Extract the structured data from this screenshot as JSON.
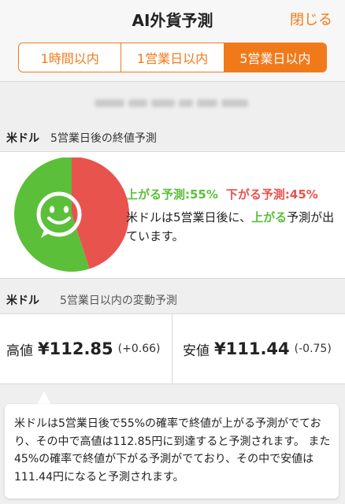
{
  "header": {
    "title": "AI外貨予測",
    "close_label": "閉じる"
  },
  "tabs": [
    {
      "label": "1時間以内",
      "active": false
    },
    {
      "label": "1営業日以内",
      "active": false
    },
    {
      "label": "5営業日以内",
      "active": true
    }
  ],
  "forecast": {
    "currency": "米ドル",
    "subtitle": "5営業日後の終値予測",
    "up_label": "上がる予測:55%",
    "down_label": "下がる予測:45%",
    "up_pct": 55,
    "down_pct": 45,
    "desc_pre": "米ドルは5営業日後に、",
    "desc_highlight": "上がる",
    "desc_post": "予測が出ています。",
    "colors": {
      "up": "#5cbf3a",
      "down": "#e8534e",
      "accent": "#f07a1a"
    }
  },
  "range": {
    "currency": "米ドル",
    "subtitle": "5営業日以内の変動予測",
    "high_label": "高値",
    "high_value": "¥112.85",
    "high_change": "(+0.66)",
    "low_label": "安値",
    "low_value": "¥111.44",
    "low_change": "(-0.75)"
  },
  "tooltip": {
    "text": "米ドルは5営業日後で55%の確率で終値が上がる予測がでており、その中で高値は112.85円に到達すると予測されます。 また45%の確率で終値が下がる予測がでており、その中で安値は111.44円になると予測されます。"
  }
}
